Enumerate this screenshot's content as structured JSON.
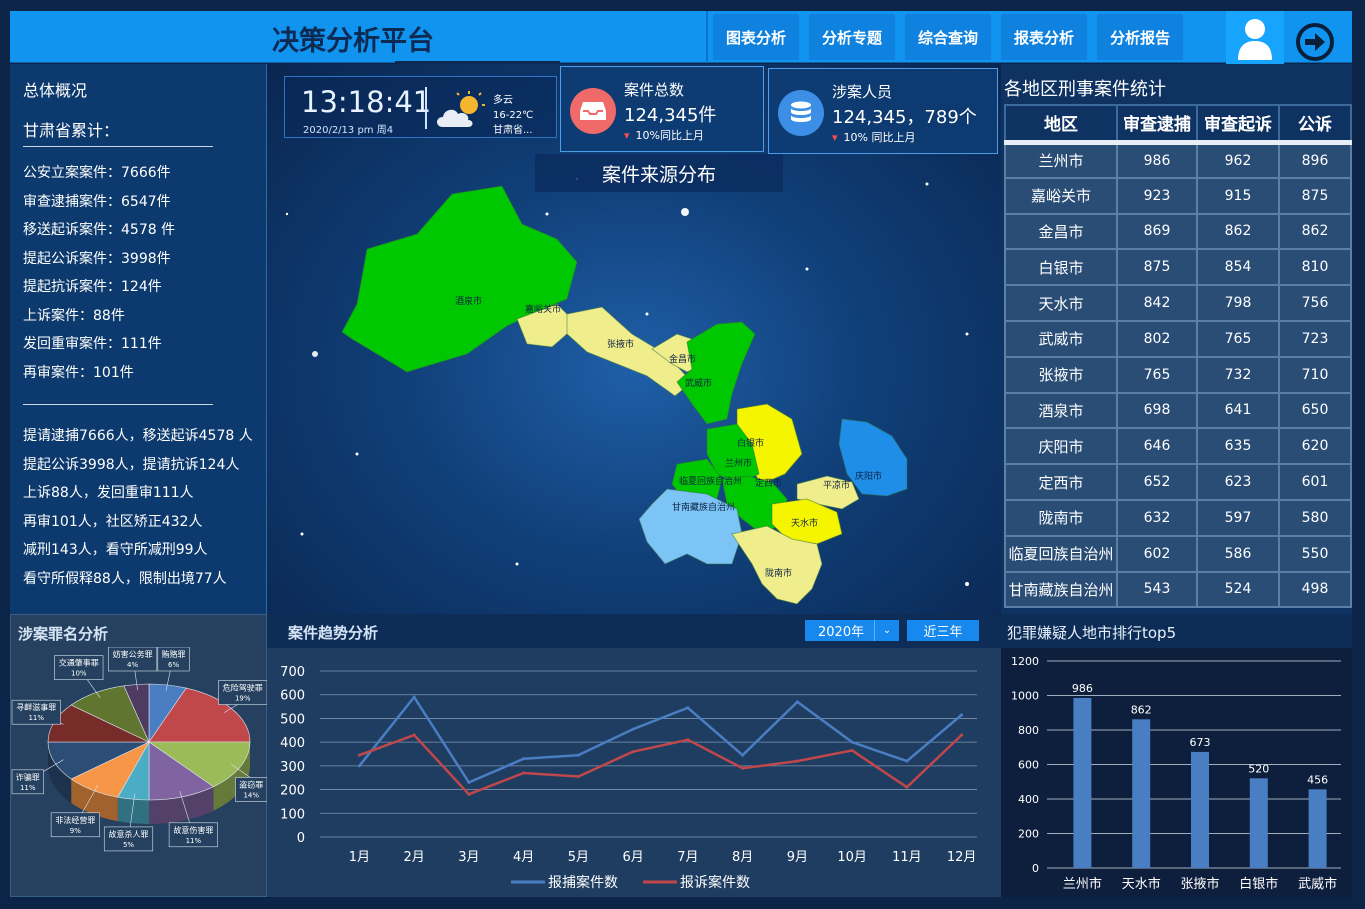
{
  "header": {
    "title": "决策分析平台",
    "nav": [
      "图表分析",
      "分析专题",
      "综合查询",
      "报表分析",
      "分析报告"
    ]
  },
  "overview": {
    "title": "总体概况",
    "subtitle": "甘肃省累计：",
    "items": [
      "公安立案案件：7666件",
      "审查逮捕案件：6547件",
      "移送起诉案件：4578 件",
      "提起公诉案件：3998件",
      "提起抗诉案件：124件",
      "上诉案件：88件",
      "发回重审案件：111件",
      "再审案件：101件"
    ],
    "people": [
      "提请逮捕7666人，移送起诉4578 人",
      "提起公诉3998人，提请抗诉124人",
      "上诉88人，发回重审111人",
      "再审101人，社区矫正432人",
      "减刑143人，看守所减刑99人",
      "看守所假释88人，限制出境77人"
    ]
  },
  "clock": {
    "time": "13:18:41",
    "date": "2020/2/13  pm  周4",
    "weather": "多云",
    "temp": "16-22℃",
    "location": "甘肃省..."
  },
  "cards": [
    {
      "label": "案件总数",
      "value": "124,345件",
      "trend": "10%同比上月",
      "icon": "inbox-icon",
      "color": "#f06a6a"
    },
    {
      "label": "涉案人员",
      "value": "124,345，789个",
      "trend": "10% 同比上月",
      "icon": "database-icon",
      "color": "#3c8ee6"
    }
  ],
  "map": {
    "title": "案件来源分布",
    "regions": [
      {
        "name": "酒泉市",
        "color": "#00c800"
      },
      {
        "name": "嘉峪关市",
        "color": "#f0ee8c"
      },
      {
        "name": "张掖市",
        "color": "#f0ee8c"
      },
      {
        "name": "金昌市",
        "color": "#f0ee8c"
      },
      {
        "name": "武威市",
        "color": "#00c800"
      },
      {
        "name": "白银市",
        "color": "#f5f500"
      },
      {
        "name": "兰州市",
        "color": "#00c800"
      },
      {
        "name": "临夏回族自治州",
        "color": "#00c800"
      },
      {
        "name": "定西市",
        "color": "#00c800"
      },
      {
        "name": "庆阳市",
        "color": "#1f8ee8"
      },
      {
        "name": "平凉市",
        "color": "#f0ee8c"
      },
      {
        "name": "天水市",
        "color": "#f5f500"
      },
      {
        "name": "甘南藏族自治州",
        "color": "#7cc4f5"
      },
      {
        "name": "陇南市",
        "color": "#f0ee8c"
      }
    ]
  },
  "table": {
    "title": "各地区刑事案件统计",
    "headers": [
      "地区",
      "审查逮捕",
      "审查起诉",
      "公诉"
    ],
    "rows": [
      [
        "兰州市",
        "986",
        "962",
        "896"
      ],
      [
        "嘉峪关市",
        "923",
        "915",
        "875"
      ],
      [
        "金昌市",
        "869",
        "862",
        "862"
      ],
      [
        "白银市",
        "875",
        "854",
        "810"
      ],
      [
        "天水市",
        "842",
        "798",
        "756"
      ],
      [
        "武威市",
        "802",
        "765",
        "723"
      ],
      [
        "张掖市",
        "765",
        "732",
        "710"
      ],
      [
        "酒泉市",
        "698",
        "641",
        "650"
      ],
      [
        "庆阳市",
        "646",
        "635",
        "620"
      ],
      [
        "定西市",
        "652",
        "623",
        "601"
      ],
      [
        "陇南市",
        "632",
        "597",
        "580"
      ],
      [
        "临夏回族自治州",
        "602",
        "586",
        "550"
      ],
      [
        "甘南藏族自治州",
        "543",
        "524",
        "498"
      ]
    ]
  },
  "crime": {
    "title": "涉案罪名分析",
    "slices": [
      {
        "name": "贿赂罪",
        "pct": 6,
        "color": "#4a7ec2"
      },
      {
        "name": "危险驾驶罪",
        "pct": 19,
        "color": "#c0474a"
      },
      {
        "name": "盗窃罪",
        "pct": 14,
        "color": "#9bbb59"
      },
      {
        "name": "故意伤害罪",
        "pct": 11,
        "color": "#8064a2"
      },
      {
        "name": "故意杀人罪",
        "pct": 5,
        "color": "#4bacc6"
      },
      {
        "name": "非法经营罪",
        "pct": 9,
        "color": "#f79646"
      },
      {
        "name": "诈骗罪",
        "pct": 11,
        "color": "#2c4d75"
      },
      {
        "name": "寻衅滋事罪",
        "pct": 11,
        "color": "#772c2a"
      },
      {
        "name": "交通肇事罪",
        "pct": 10,
        "color": "#5f7530"
      },
      {
        "name": "妨害公务罪",
        "pct": 4,
        "color": "#4d3b62"
      }
    ]
  },
  "trend": {
    "title": "案件趋势分析",
    "year": "2020年",
    "range": "近三年",
    "chart_data": {
      "type": "line",
      "categories": [
        "1月",
        "2月",
        "3月",
        "4月",
        "5月",
        "6月",
        "7月",
        "8月",
        "9月",
        "10月",
        "11月",
        "12月"
      ],
      "ylim": [
        0,
        700
      ],
      "yticks": [
        0,
        100,
        200,
        300,
        400,
        500,
        600,
        700
      ],
      "series": [
        {
          "name": "报捕案件数",
          "color": "#4a7ec2",
          "values": [
            300,
            590,
            230,
            330,
            345,
            455,
            545,
            345,
            570,
            400,
            320,
            515
          ]
        },
        {
          "name": "报诉案件数",
          "color": "#c0474a",
          "values": [
            345,
            430,
            180,
            270,
            255,
            360,
            410,
            290,
            320,
            365,
            210,
            430
          ]
        }
      ]
    }
  },
  "rank": {
    "title": "犯罪嫌疑人地市排行top5",
    "chart_data": {
      "type": "bar",
      "categories": [
        "兰州市",
        "天水市",
        "张掖市",
        "白银市",
        "武威市"
      ],
      "values": [
        986,
        862,
        673,
        520,
        456
      ],
      "ylim": [
        0,
        1200
      ],
      "yticks": [
        0,
        200,
        400,
        600,
        800,
        1000,
        1200
      ],
      "color": "#4a7ec2"
    }
  }
}
